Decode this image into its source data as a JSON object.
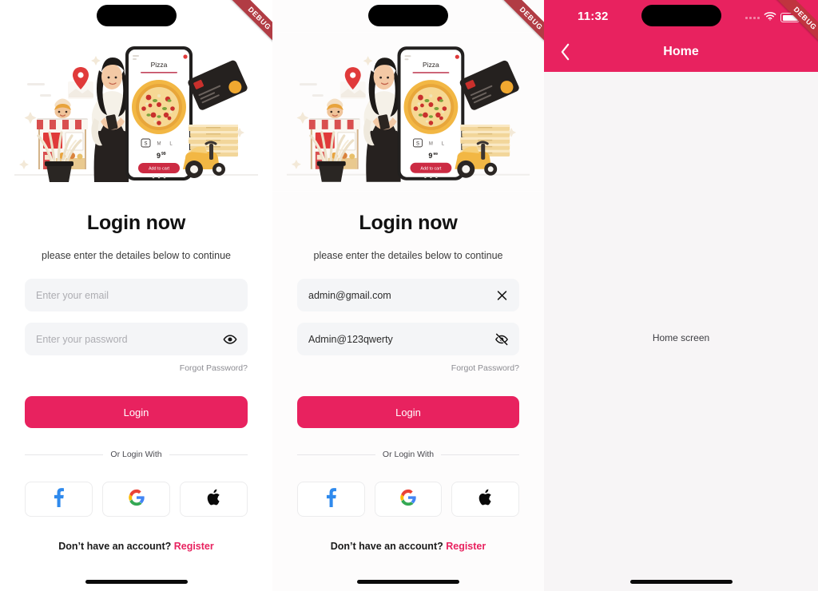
{
  "ribbon": {
    "label": "DEBUG"
  },
  "login_screen": {
    "title": "Login now",
    "subtitle": "please enter the detailes below to continue",
    "email_field": {
      "placeholder": "Enter your email",
      "value": "admin@gmail.com",
      "clear_icon": "close-icon"
    },
    "password_field": {
      "placeholder": "Enter your password",
      "value": "Admin@123qwerty",
      "visible_icon": "eye-icon",
      "hidden_icon": "eye-off-icon"
    },
    "forgot_label": "Forgot Password?",
    "login_button": "Login",
    "divider_label": "Or Login With",
    "socials": [
      {
        "name": "facebook",
        "icon": "facebook-icon"
      },
      {
        "name": "google",
        "icon": "google-icon"
      },
      {
        "name": "apple",
        "icon": "apple-icon"
      }
    ],
    "signup_prefix": "Don’t have an account? ",
    "signup_link": "Register"
  },
  "illustration": {
    "phone_title": "Pizza",
    "sizes": [
      "S",
      "M",
      "L"
    ],
    "price": "9",
    "price_sup": "99",
    "cta": "Add to cart"
  },
  "home_screen": {
    "status_time": "11:32",
    "nav_title": "Home",
    "back_icon": "chevron-left-icon",
    "wifi_icon": "wifi-icon",
    "battery_icon": "battery-icon",
    "signal_icon": "signal-dots-icon",
    "body_text": "Home screen"
  },
  "colors": {
    "accent_pink": "#e8225f",
    "field_bg": "#f4f5f7",
    "ribbon_red": "#b13c44",
    "page_bg": "#f7f5f6"
  }
}
